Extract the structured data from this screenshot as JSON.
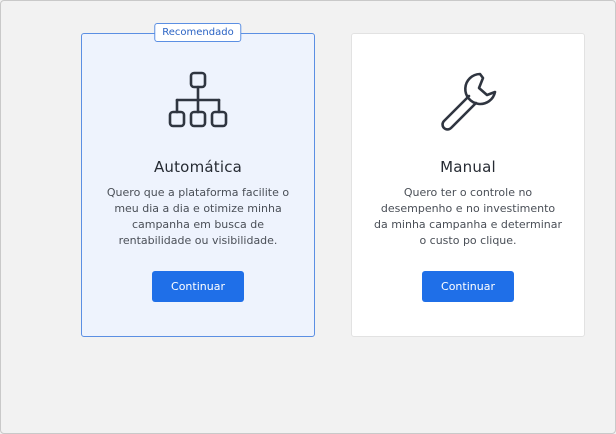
{
  "cards": [
    {
      "badge": "Recomendado",
      "title": "Automática",
      "description": "Quero que a plataforma facilite o meu dia a dia e otimize minha campanha em busca de rentabilidade ou visibilidade.",
      "button_label": "Continuar",
      "icon": "hierarchy-icon"
    },
    {
      "title": "Manual",
      "description": "Quero ter o controle no desempenho e no investimento da minha campanha e determinar o custo po clique.",
      "button_label": "Continuar",
      "icon": "wrench-icon"
    }
  ],
  "colors": {
    "accent": "#1f6fe8",
    "selected_card_bg": "#eef3fd",
    "selected_card_border": "#5b8fe3"
  }
}
